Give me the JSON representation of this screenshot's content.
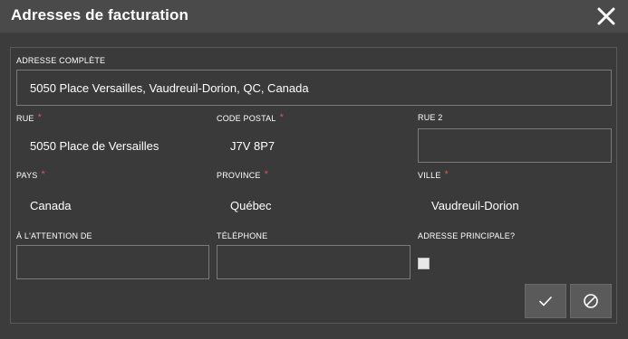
{
  "dialog": {
    "title": "Adresses de facturation",
    "close_icon": "close-icon"
  },
  "form": {
    "full_address": {
      "label": "ADRESSE COMPLÈTE",
      "value": "5050 Place Versailles, Vaudreuil-Dorion, QC, Canada"
    },
    "street": {
      "label": "RUE",
      "required": "*",
      "value": "5050 Place de Versailles"
    },
    "postal_code": {
      "label": "CODE POSTAL",
      "required": "*",
      "value": "J7V 8P7"
    },
    "street2": {
      "label": "RUE 2",
      "value": ""
    },
    "country": {
      "label": "PAYS",
      "required": "*",
      "value": "Canada"
    },
    "province": {
      "label": "PROVINCE",
      "required": "*",
      "value": "Québec"
    },
    "city": {
      "label": "VILLE",
      "required": "*",
      "value": "Vaudreuil-Dorion"
    },
    "attention": {
      "label": "À L'ATTENTION DE",
      "value": ""
    },
    "phone": {
      "label": "TÉLÉPHONE",
      "value": ""
    },
    "primary": {
      "label": "ADRESSE PRINCIPALE?",
      "checked": false
    }
  },
  "actions": {
    "confirm_icon": "checkmark-icon",
    "cancel_icon": "cancel-circle-icon"
  },
  "colors": {
    "required": "#d9534f",
    "background": "#3c3c3c",
    "titlebar": "#4a4a4a"
  }
}
